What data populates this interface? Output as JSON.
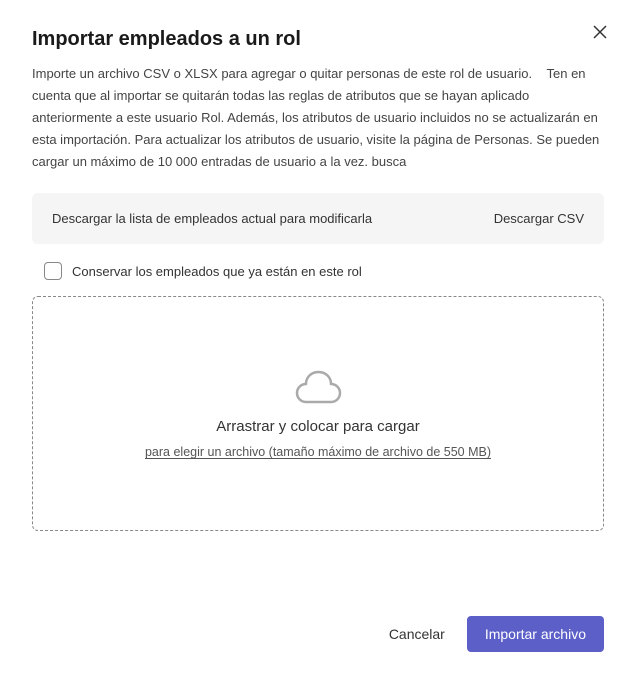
{
  "dialog": {
    "title": "Importar empleados a un rol",
    "description": "Importe un archivo CSV o XLSX para agregar o quitar personas de este rol de usuario.    Ten en cuenta que al importar se quitarán todas las reglas de atributos que se hayan aplicado anteriormente a este usuario Rol. Además, los atributos de usuario incluidos no se actualizarán en esta importación. Para actualizar los atributos de usuario, visite la página de Personas. Se pueden cargar un máximo de 10 000 entradas de usuario a la vez. busca"
  },
  "download": {
    "label": "Descargar la lista de empleados actual para modificarla",
    "action": "Descargar CSV"
  },
  "checkbox": {
    "label": "Conservar los empleados que ya están en este rol"
  },
  "dropzone": {
    "title": "Arrastrar y colocar para cargar",
    "subtitle": "para elegir un archivo (tamaño máximo de archivo de 550 MB)"
  },
  "footer": {
    "cancel": "Cancelar",
    "import": "Importar archivo"
  }
}
